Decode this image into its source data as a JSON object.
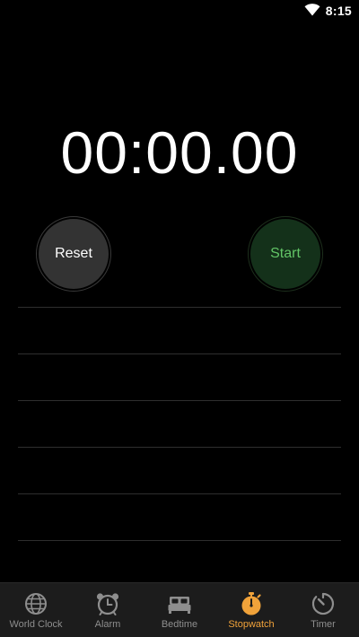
{
  "status_bar": {
    "time": "8:15",
    "wifi_icon": "wifi-icon"
  },
  "stopwatch": {
    "display": "00:00.00",
    "reset_label": "Reset",
    "start_label": "Start",
    "lap_count": 0
  },
  "tabs": [
    {
      "label": "World Clock",
      "icon": "globe-icon",
      "active": false
    },
    {
      "label": "Alarm",
      "icon": "alarm-clock-icon",
      "active": false
    },
    {
      "label": "Bedtime",
      "icon": "bed-icon",
      "active": false
    },
    {
      "label": "Stopwatch",
      "icon": "stopwatch-icon",
      "active": true
    },
    {
      "label": "Timer",
      "icon": "timer-icon",
      "active": false
    }
  ],
  "colors": {
    "accent": "#f0a23a",
    "start_text": "#62c466",
    "start_bg": "#14311a",
    "reset_bg": "#333333",
    "tab_inactive": "#8e8e8e"
  }
}
